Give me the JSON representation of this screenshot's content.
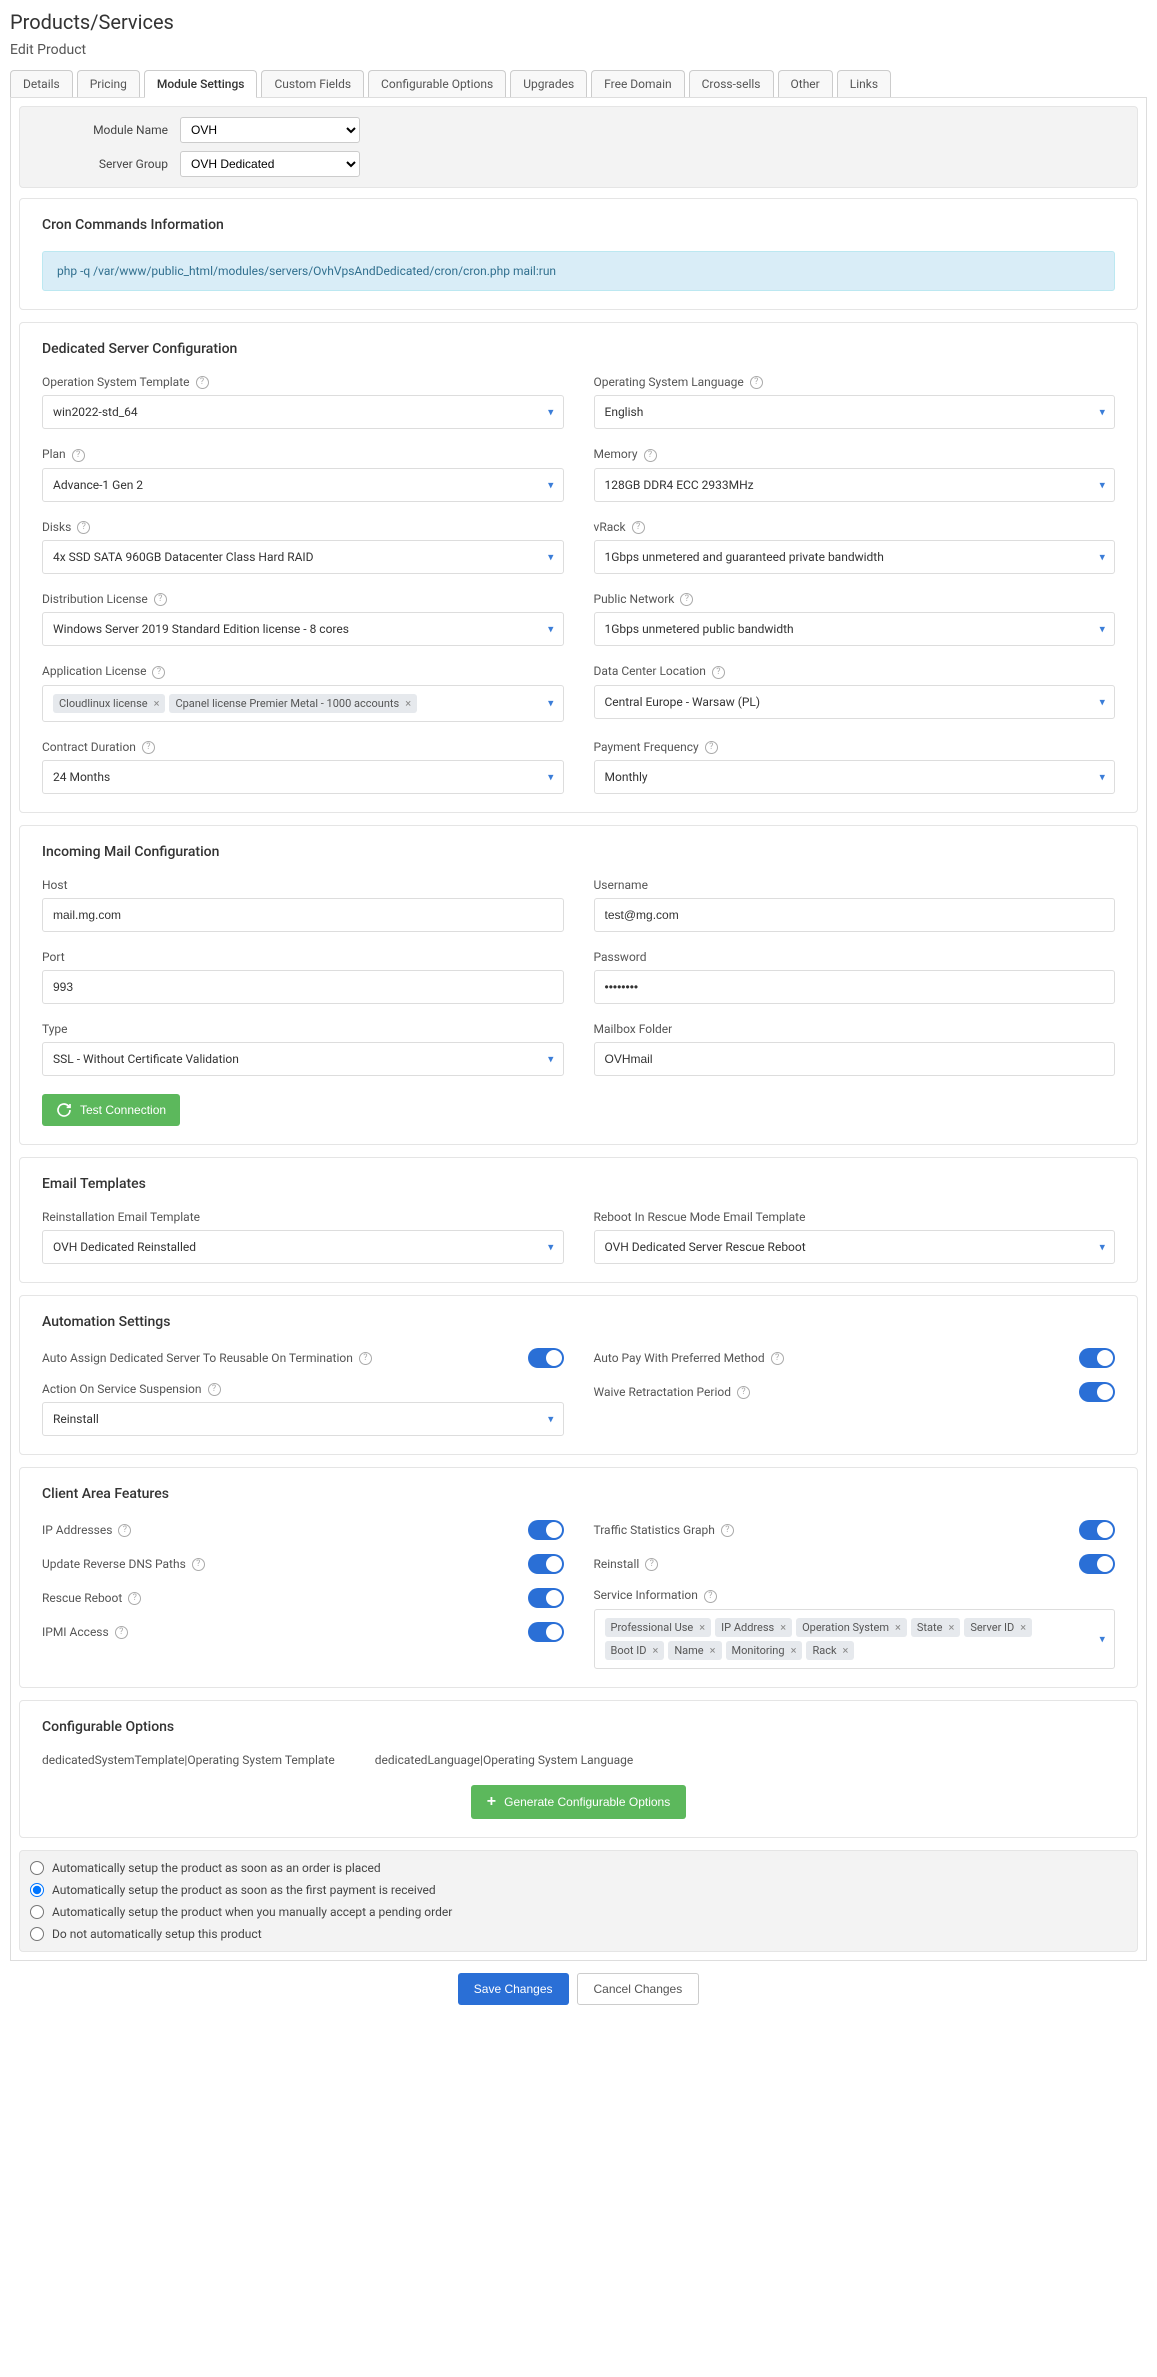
{
  "page": {
    "title": "Products/Services",
    "subtitle": "Edit Product"
  },
  "tabs": [
    "Details",
    "Pricing",
    "Module Settings",
    "Custom Fields",
    "Configurable Options",
    "Upgrades",
    "Free Domain",
    "Cross-sells",
    "Other",
    "Links"
  ],
  "activeTab": "Module Settings",
  "moduleHeader": {
    "moduleNameLabel": "Module Name",
    "moduleName": "OVH",
    "serverGroupLabel": "Server Group",
    "serverGroup": "OVH Dedicated"
  },
  "cron": {
    "title": "Cron Commands Information",
    "command": "php -q /var/www/public_html/modules/servers/OvhVpsAndDedicated/cron/cron.php mail:run"
  },
  "dedicated": {
    "title": "Dedicated Server Configuration",
    "fields": {
      "osTemplateLabel": "Operation System Template",
      "osTemplate": "win2022-std_64",
      "osLangLabel": "Operating System Language",
      "osLang": "English",
      "planLabel": "Plan",
      "plan": "Advance-1 Gen 2",
      "memoryLabel": "Memory",
      "memory": "128GB DDR4 ECC 2933MHz",
      "disksLabel": "Disks",
      "disks": "4x SSD SATA 960GB Datacenter Class Hard RAID",
      "vrackLabel": "vRack",
      "vrack": "1Gbps unmetered and guaranteed private bandwidth",
      "distLicLabel": "Distribution License",
      "distLic": "Windows Server 2019 Standard Edition license - 8 cores",
      "pubNetLabel": "Public Network",
      "pubNet": "1Gbps unmetered public bandwidth",
      "appLicLabel": "Application License",
      "appLicTags": [
        "Cloudlinux license",
        "Cpanel license Premier Metal - 1000 accounts"
      ],
      "dcLabel": "Data Center Location",
      "dc": "Central Europe - Warsaw (PL)",
      "contractLabel": "Contract Duration",
      "contract": "24 Months",
      "payFreqLabel": "Payment Frequency",
      "payFreq": "Monthly"
    }
  },
  "mail": {
    "title": "Incoming Mail Configuration",
    "hostLabel": "Host",
    "host": "mail.mg.com",
    "userLabel": "Username",
    "user": "test@mg.com",
    "portLabel": "Port",
    "port": "993",
    "passLabel": "Password",
    "pass": "••••••••",
    "typeLabel": "Type",
    "type": "SSL - Without Certificate Validation",
    "mboxLabel": "Mailbox Folder",
    "mbox": "OVHmail",
    "testBtn": "Test Connection"
  },
  "emailTemplates": {
    "title": "Email Templates",
    "reinstallLabel": "Reinstallation Email Template",
    "reinstall": "OVH Dedicated Reinstalled",
    "rebootLabel": "Reboot In Rescue Mode Email Template",
    "reboot": "OVH Dedicated Server Rescue Reboot"
  },
  "automation": {
    "title": "Automation Settings",
    "autoAssign": "Auto Assign Dedicated Server To Reusable On Termination",
    "autoPay": "Auto Pay With Preferred Method",
    "actionSuspLabel": "Action On Service Suspension",
    "actionSusp": "Reinstall",
    "waive": "Waive Retractation Period"
  },
  "clientArea": {
    "title": "Client Area Features",
    "ip": "IP Addresses",
    "traffic": "Traffic Statistics Graph",
    "reverse": "Update Reverse DNS Paths",
    "reinstall": "Reinstall",
    "rescue": "Rescue Reboot",
    "serviceInfoLabel": "Service Information",
    "ipmi": "IPMI Access",
    "serviceInfoTags": [
      "Professional Use",
      "IP Address",
      "Operation System",
      "State",
      "Server ID",
      "Boot ID",
      "Name",
      "Monitoring",
      "Rack"
    ]
  },
  "configOptions": {
    "title": "Configurable Options",
    "opt1": "dedicatedSystemTemplate|Operating System Template",
    "opt2": "dedicatedLanguage|Operating System Language",
    "genBtn": "Generate Configurable Options"
  },
  "setupRadios": [
    "Automatically setup the product as soon as an order is placed",
    "Automatically setup the product as soon as the first payment is received",
    "Automatically setup the product when you manually accept a pending order",
    "Do not automatically setup this product"
  ],
  "setupSelected": 1,
  "footer": {
    "save": "Save Changes",
    "cancel": "Cancel Changes"
  }
}
